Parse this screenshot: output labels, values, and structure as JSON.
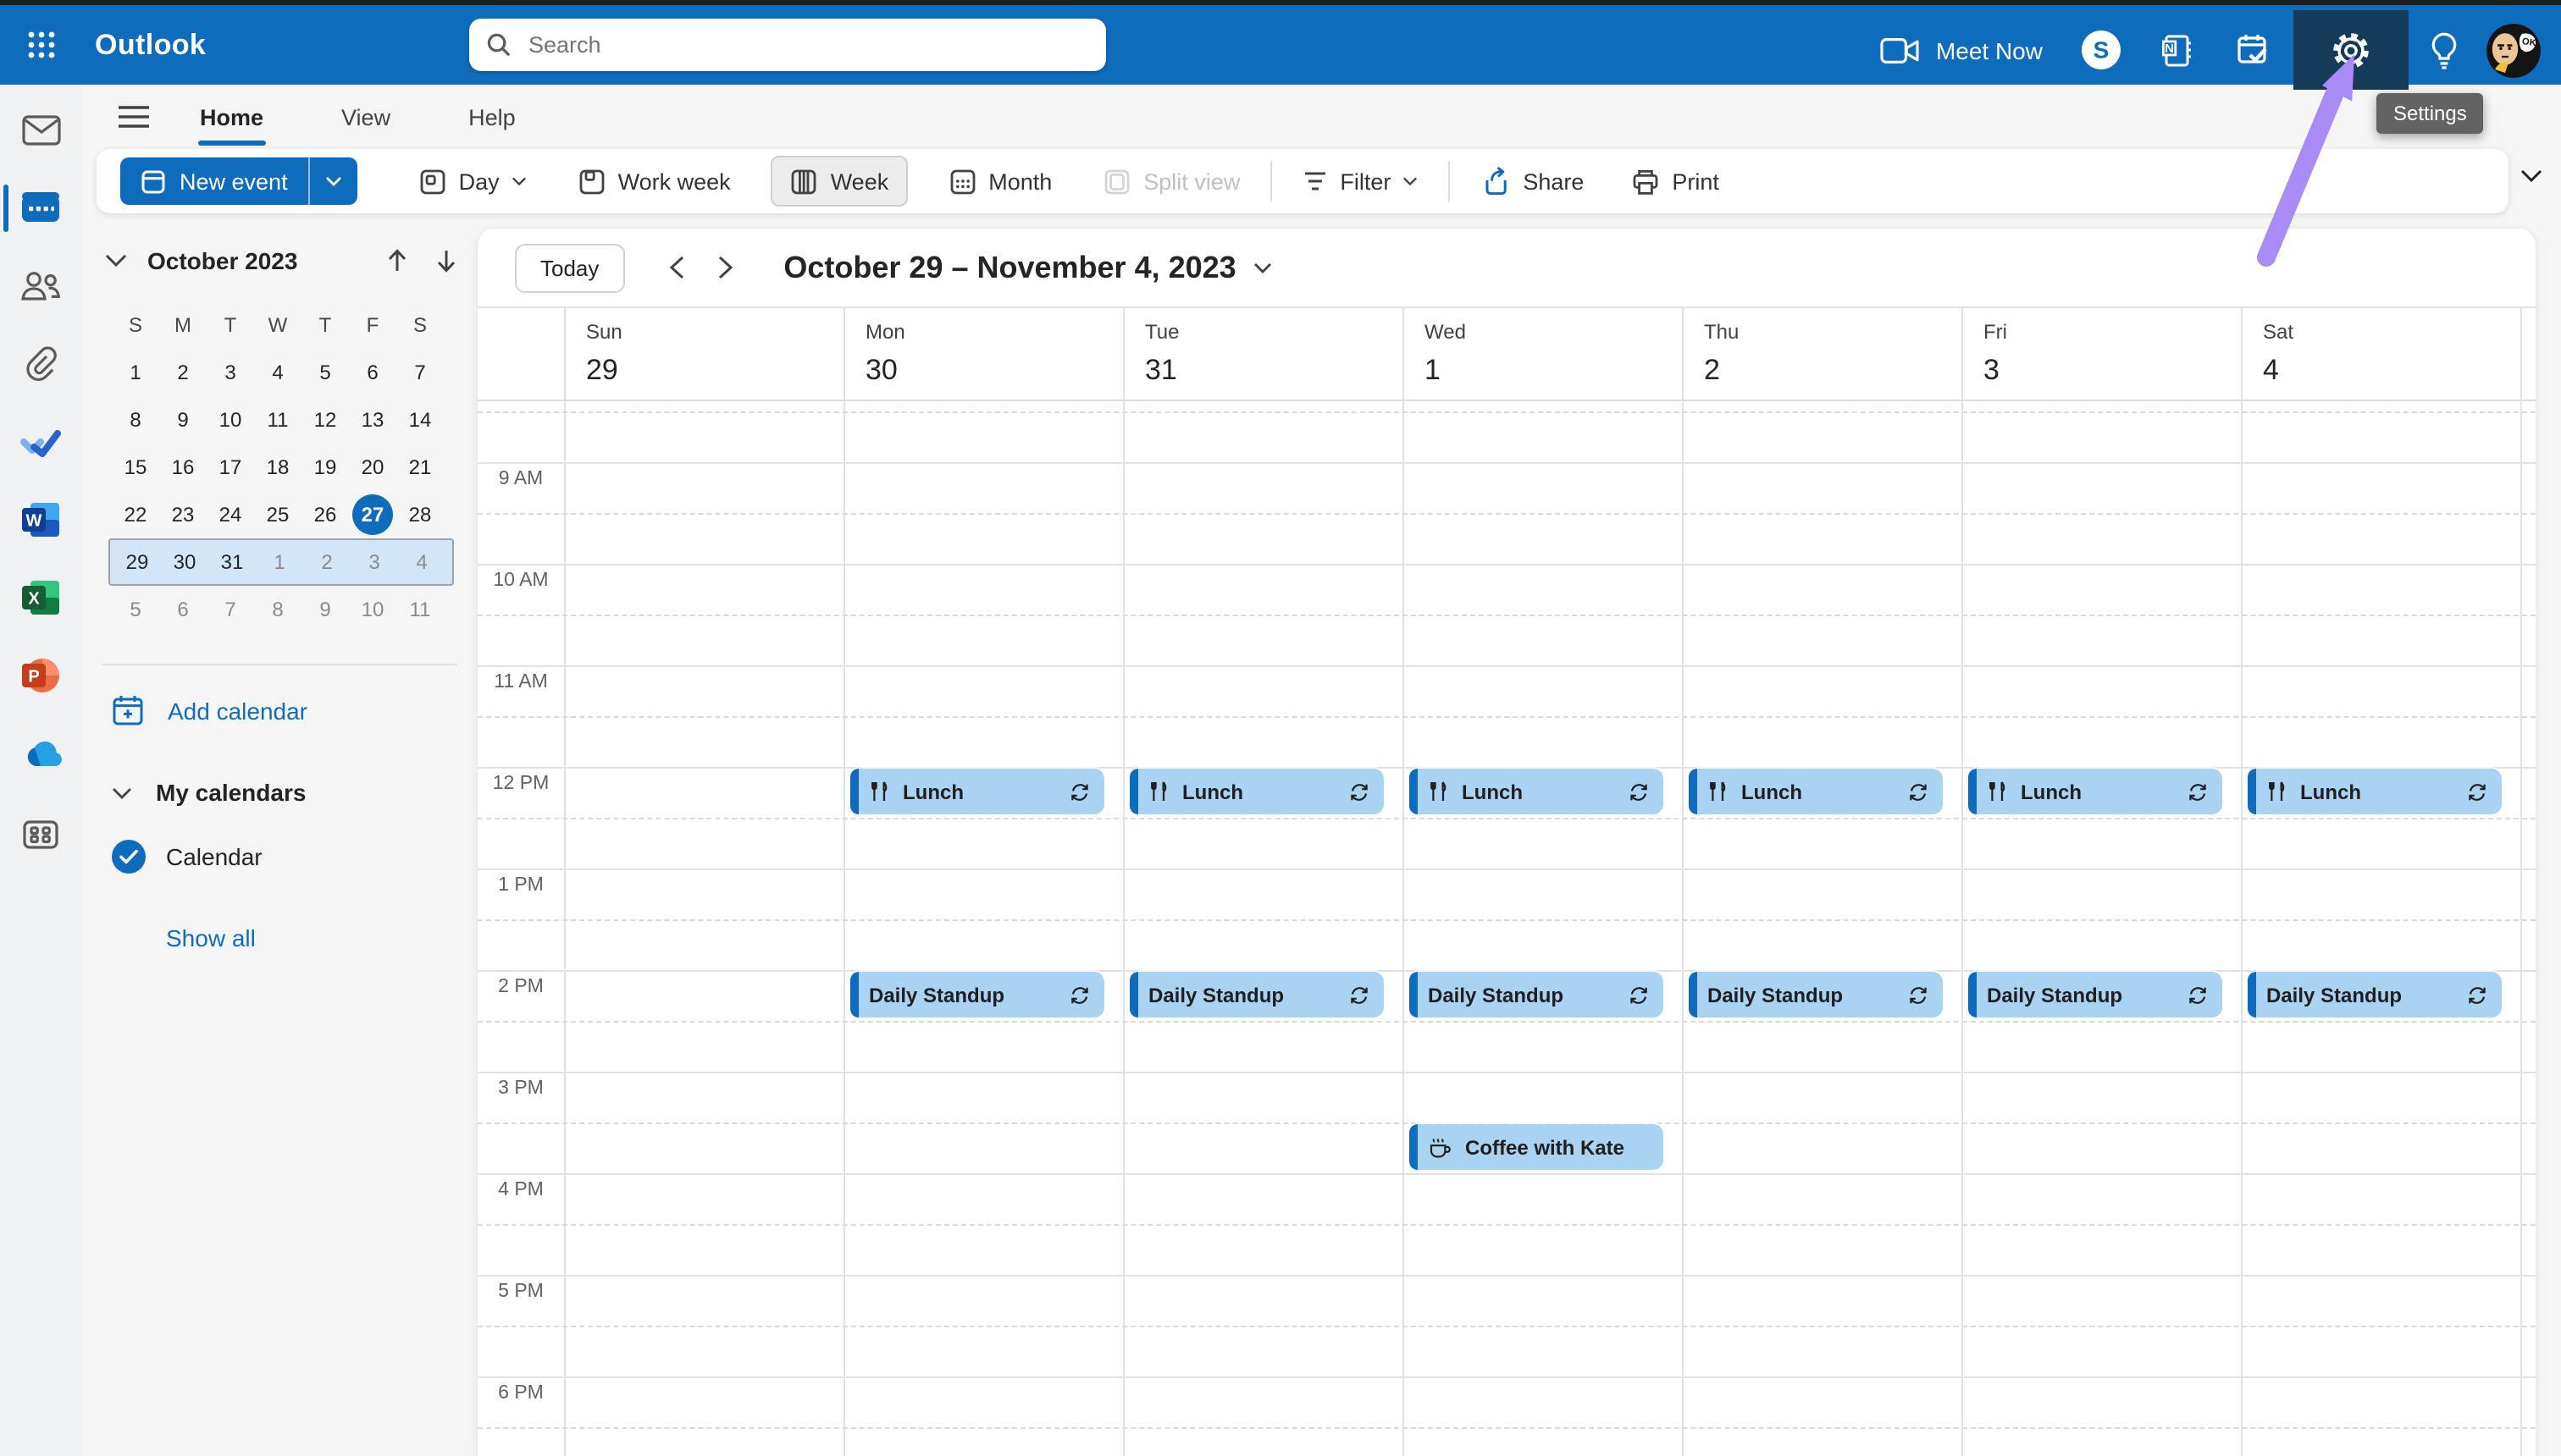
{
  "header": {
    "app_name": "Outlook",
    "search_placeholder": "Search",
    "meet_now_label": "Meet Now",
    "settings_tooltip": "Settings"
  },
  "nav_tabs": {
    "home": "Home",
    "view": "View",
    "help": "Help"
  },
  "ribbon": {
    "new_event": "New event",
    "day": "Day",
    "work_week": "Work week",
    "week": "Week",
    "month": "Month",
    "split_view": "Split view",
    "filter": "Filter",
    "share": "Share",
    "print": "Print"
  },
  "rail_icons": [
    "mail",
    "calendar",
    "people",
    "paperclip",
    "todo",
    "word",
    "excel",
    "powerpoint",
    "onedrive",
    "more-apps"
  ],
  "mini_calendar": {
    "title": "October 2023",
    "dow": [
      "S",
      "M",
      "T",
      "W",
      "T",
      "F",
      "S"
    ],
    "weeks": [
      [
        "1",
        "2",
        "3",
        "4",
        "5",
        "6",
        "7"
      ],
      [
        "8",
        "9",
        "10",
        "11",
        "12",
        "13",
        "14"
      ],
      [
        "15",
        "16",
        "17",
        "18",
        "19",
        "20",
        "21"
      ],
      [
        "22",
        "23",
        "24",
        "25",
        "26",
        "27",
        "28"
      ],
      [
        "29",
        "30",
        "31",
        "1",
        "2",
        "3",
        "4"
      ],
      [
        "5",
        "6",
        "7",
        "8",
        "9",
        "10",
        "11"
      ]
    ],
    "selected_day": "27",
    "highlighted_week": [
      "29",
      "30",
      "31",
      "1",
      "2",
      "3",
      "4"
    ]
  },
  "sidebar": {
    "add_calendar": "Add calendar",
    "my_calendars": "My calendars",
    "calendar_name": "Calendar",
    "show_all": "Show all"
  },
  "toolbar": {
    "today": "Today",
    "date_range": "October 29 – November 4, 2023"
  },
  "week_view": {
    "days": [
      {
        "name": "Sun",
        "num": "29"
      },
      {
        "name": "Mon",
        "num": "30"
      },
      {
        "name": "Tue",
        "num": "31"
      },
      {
        "name": "Wed",
        "num": "1"
      },
      {
        "name": "Thu",
        "num": "2"
      },
      {
        "name": "Fri",
        "num": "3"
      },
      {
        "name": "Sat",
        "num": "4"
      }
    ],
    "times": [
      "9 AM",
      "10 AM",
      "11 AM",
      "12 PM",
      "1 PM",
      "2 PM",
      "3 PM",
      "4 PM",
      "5 PM",
      "6 PM"
    ],
    "events": [
      {
        "title": "Lunch",
        "day": "Mon",
        "start": "12:00 PM",
        "end": "12:30 PM",
        "icon": "utensils-icon",
        "recurring": true
      },
      {
        "title": "Lunch",
        "day": "Tue",
        "start": "12:00 PM",
        "end": "12:30 PM",
        "icon": "utensils-icon",
        "recurring": true
      },
      {
        "title": "Lunch",
        "day": "Wed",
        "start": "12:00 PM",
        "end": "12:30 PM",
        "icon": "utensils-icon",
        "recurring": true
      },
      {
        "title": "Lunch",
        "day": "Thu",
        "start": "12:00 PM",
        "end": "12:30 PM",
        "icon": "utensils-icon",
        "recurring": true
      },
      {
        "title": "Lunch",
        "day": "Fri",
        "start": "12:00 PM",
        "end": "12:30 PM",
        "icon": "utensils-icon",
        "recurring": true
      },
      {
        "title": "Lunch",
        "day": "Sat",
        "start": "12:00 PM",
        "end": "12:30 PM",
        "icon": "utensils-icon",
        "recurring": true
      },
      {
        "title": "Daily Standup",
        "day": "Mon",
        "start": "2:00 PM",
        "end": "2:30 PM",
        "recurring": true
      },
      {
        "title": "Daily Standup",
        "day": "Tue",
        "start": "2:00 PM",
        "end": "2:30 PM",
        "recurring": true
      },
      {
        "title": "Daily Standup",
        "day": "Wed",
        "start": "2:00 PM",
        "end": "2:30 PM",
        "recurring": true
      },
      {
        "title": "Daily Standup",
        "day": "Thu",
        "start": "2:00 PM",
        "end": "2:30 PM",
        "recurring": true
      },
      {
        "title": "Daily Standup",
        "day": "Fri",
        "start": "2:00 PM",
        "end": "2:30 PM",
        "recurring": true
      },
      {
        "title": "Daily Standup",
        "day": "Sat",
        "start": "2:00 PM",
        "end": "2:30 PM",
        "recurring": true
      },
      {
        "title": "Coffee with Kate",
        "day": "Wed",
        "start": "3:30 PM",
        "end": "4:00 PM",
        "icon": "coffee-cup-icon",
        "recurring": false
      }
    ]
  },
  "colors": {
    "header_blue": "#0f6cbd",
    "settings_pressed": "#143c5a",
    "event_fill": "#a9d3f2",
    "event_bar": "#0f6cbd",
    "week_highlight": "#d3e6f8",
    "tooltip_bg": "#636363",
    "arrow_purple": "#a98bf5"
  }
}
